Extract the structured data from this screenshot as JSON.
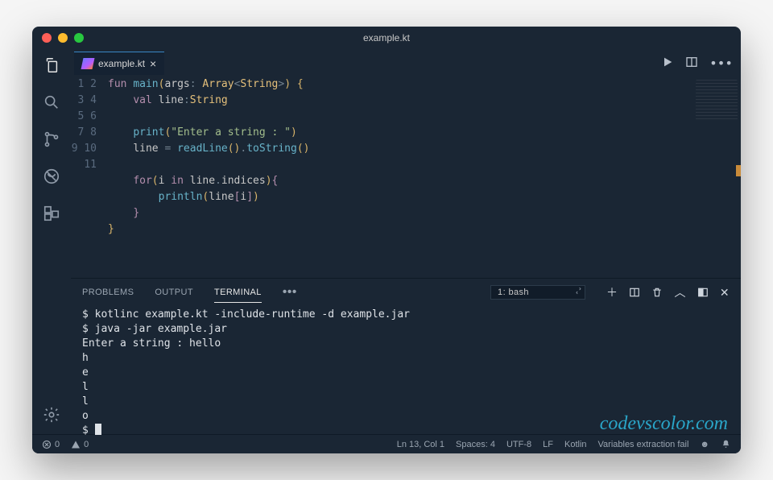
{
  "window": {
    "title": "example.kt"
  },
  "tab": {
    "filename": "example.kt"
  },
  "code": {
    "line_count": 11,
    "l1_kw_fun": "fun",
    "l1_fn": "main",
    "l1_args": "args",
    "l1_type_arr": "Array",
    "l1_type_str": "String",
    "l2_kw_val": "val",
    "l2_id": "line",
    "l2_type": "String",
    "l4_fn": "print",
    "l4_str": "\"Enter a string : \"",
    "l5_id": "line",
    "l5_fn1": "readLine",
    "l5_fn2": "toString",
    "l7_kw_for": "for",
    "l7_i": "i",
    "l7_kw_in": "in",
    "l7_line": "line",
    "l7_prop": "indices",
    "l8_fn": "println",
    "l8_line": "line",
    "l8_i": "i"
  },
  "panel": {
    "tab_problems": "PROBLEMS",
    "tab_output": "OUTPUT",
    "tab_terminal": "TERMINAL",
    "term_selector": "1: bash"
  },
  "terminal": {
    "l1": "$ kotlinc example.kt -include-runtime -d example.jar",
    "l2": "$ java -jar example.jar",
    "l3": "Enter a string : hello",
    "l4": "h",
    "l5": "e",
    "l6": "l",
    "l7": "l",
    "l8": "o",
    "l9": "$ "
  },
  "watermark": "codevscolor.com",
  "status": {
    "errors": "0",
    "warnings": "0",
    "cursor": "Ln 13, Col 1",
    "spaces": "Spaces: 4",
    "encoding": "UTF-8",
    "eol": "LF",
    "lang": "Kotlin",
    "msg": "Variables extraction fail"
  }
}
